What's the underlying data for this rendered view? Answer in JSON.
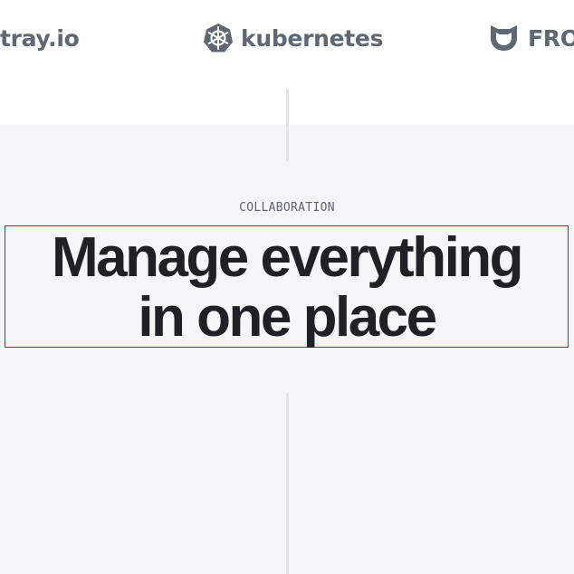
{
  "logos": {
    "tray": "tray.io",
    "kubernetes": "kubernetes",
    "fro": "FRO"
  },
  "section": {
    "eyebrow": "COLLABORATION",
    "headline_line1": "Manage everything",
    "headline_line2": "in one place"
  },
  "colors": {
    "logo_gray": "#5e6872",
    "section_bg": "#f5f6f8",
    "headline": "#1f2126",
    "divider": "#e3e5e8",
    "highlight_border": "#b22222"
  }
}
